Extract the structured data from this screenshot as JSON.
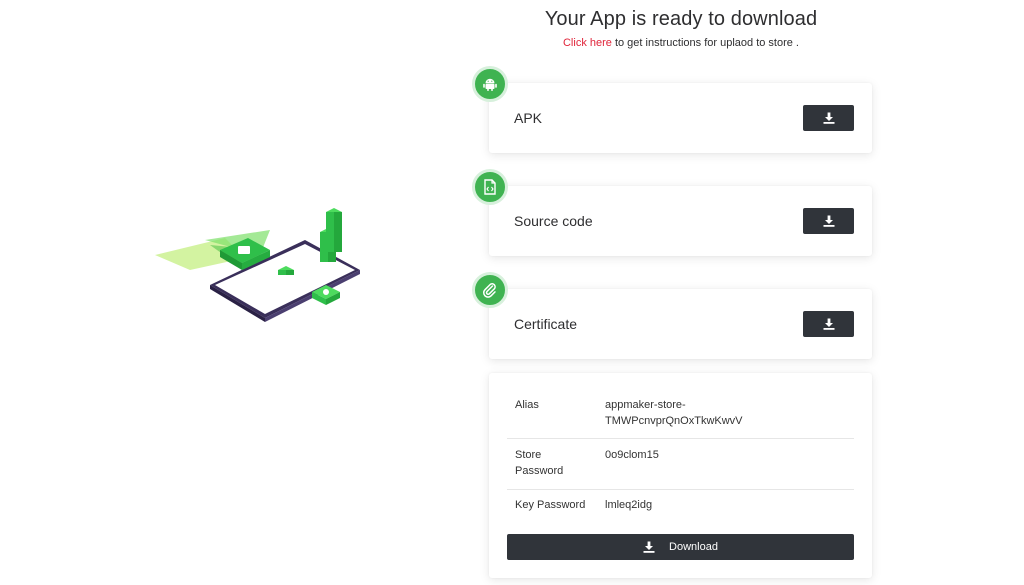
{
  "header": {
    "title": "Your App is ready to download",
    "link_text": "Click here",
    "subtitle_rest": " to get instructions for uplaod to store ."
  },
  "files": [
    {
      "label": "APK",
      "icon": "android-icon"
    },
    {
      "label": "Source code",
      "icon": "file-code-icon"
    },
    {
      "label": "Certificate",
      "icon": "paperclip-icon"
    }
  ],
  "certificate": {
    "rows": [
      {
        "key": "Alias",
        "value": "appmaker-store-TMWPcnvprQnOxTkwKwvV"
      },
      {
        "key": "Store Password",
        "value": "0o9clom15"
      },
      {
        "key": "Key Password",
        "value": "lmleq2idg"
      }
    ],
    "download_label": "Download"
  },
  "colors": {
    "accent_green": "#3fb351",
    "button_dark": "#30343a",
    "link_red": "#e0243a"
  }
}
